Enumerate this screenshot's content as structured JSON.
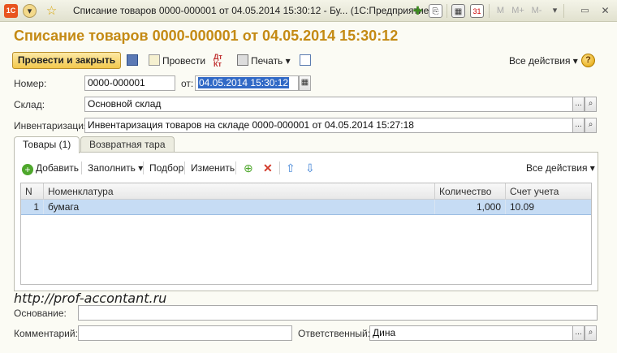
{
  "titlebar": {
    "app_logo": "1С",
    "title": "Списание товаров 0000-000001 от 04.05.2014 15:30:12 - Бу... (1С:Предприятие)",
    "icons": [
      "1c-logo-icon",
      "menu-down-icon",
      "star-icon",
      "favorite-add-icon",
      "link-icon",
      "calculator-icon",
      "calendar-icon",
      "m-icon",
      "m-plus-icon",
      "m-minus-icon",
      "restore-icon",
      "minimize-icon",
      "close-icon"
    ],
    "m_label": "M",
    "mplus_label": "M+",
    "mminus_label": "M-",
    "close_glyph": "✕"
  },
  "header": {
    "title": "Списание товаров 0000-000001 от 04.05.2014 15:30:12"
  },
  "toolbar": {
    "post_close": "Провести и закрыть",
    "post": "Провести",
    "print": "Печать",
    "all_actions": "Все действия",
    "help": "?"
  },
  "form": {
    "number_label": "Номер:",
    "number_value": "0000-000001",
    "date_label": "от:",
    "date_value": "04.05.2014 15:30:12",
    "warehouse_label": "Склад:",
    "warehouse_value": "Основной склад",
    "inventory_label": "Инвентаризация:",
    "inventory_value": "Инвентаризация товаров на складе 0000-000001 от 04.05.2014 15:27:18",
    "basis_label": "Основание:",
    "basis_value": "",
    "comment_label": "Комментарий:",
    "comment_value": "",
    "responsible_label": "Ответственный:",
    "responsible_value": "Дина",
    "ellipsis": "...",
    "search_glyph": "🔍"
  },
  "tabs": [
    {
      "label": "Товары (1)"
    },
    {
      "label": "Возвратная тара"
    }
  ],
  "panel_toolbar": {
    "add": "Добавить",
    "fill": "Заполнить",
    "pick": "Подбор",
    "edit": "Изменить",
    "all_actions": "Все действия"
  },
  "table": {
    "columns": [
      "N",
      "Номенклатура",
      "Количество",
      "Счет учета"
    ],
    "rows": [
      {
        "n": "1",
        "item": "бумага",
        "qty": "1,000",
        "account": "10.09"
      }
    ]
  },
  "watermark": "http://prof-accontant.ru",
  "colors": {
    "title": "#c48a14",
    "selection_row": "#c6dcf4",
    "button_gold": "#f3c84d"
  }
}
